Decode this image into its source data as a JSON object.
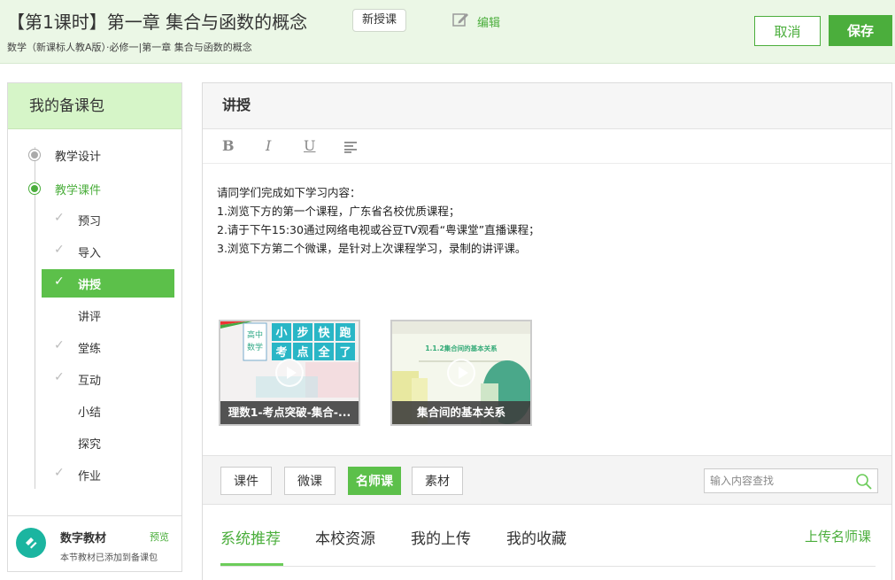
{
  "header": {
    "title": "【第1课时】第一章 集合与函数的概念",
    "lesson_type": "新授课",
    "edit_label": "编辑",
    "subtitle": "数学（新课标人教A版）·必修一|第一章 集合与函数的概念",
    "cancel_label": "取消",
    "save_label": "保存"
  },
  "sidebar": {
    "title": "我的备课包",
    "main_items": [
      {
        "label": "教学设计",
        "active": false
      },
      {
        "label": "教学课件",
        "active": true
      }
    ],
    "sub_items": [
      {
        "label": "预习",
        "checked": true,
        "active": false
      },
      {
        "label": "导入",
        "checked": true,
        "active": false
      },
      {
        "label": "讲授",
        "checked": true,
        "active": true
      },
      {
        "label": "讲评",
        "checked": false,
        "active": false
      },
      {
        "label": "堂练",
        "checked": true,
        "active": false
      },
      {
        "label": "互动",
        "checked": true,
        "active": false
      },
      {
        "label": "小结",
        "checked": false,
        "active": false
      },
      {
        "label": "探究",
        "checked": false,
        "active": false
      },
      {
        "label": "作业",
        "checked": true,
        "active": false
      }
    ],
    "digital": {
      "title": "数字教材",
      "preview_label": "预览",
      "note": "本节教材已添加到备课包"
    }
  },
  "main": {
    "section_title": "讲授",
    "toolbar": {
      "bold": "B",
      "italic": "I",
      "underline": "U"
    },
    "content_lines": [
      "请同学们完成如下学习内容：",
      "1.浏览下方的第一个课程，广东省名校优质课程；",
      "2.请于下午15:30通过网络电视或谷豆TV观看“粤课堂”直播课程；",
      "3.浏览下方第二个微课，是针对上次课程学习，录制的讲评课。"
    ],
    "videos": [
      {
        "caption": "理数1-考点突破-集合-...",
        "thumb_text": [
          "高中",
          "数学",
          "小",
          "步",
          "快",
          "跑",
          "考",
          "点",
          "全",
          "了"
        ]
      },
      {
        "caption": "集合间的基本关系",
        "thumb_text": [
          "1.1.2集合间的基本关系"
        ]
      }
    ],
    "resource_buttons": [
      {
        "label": "课件",
        "active": false
      },
      {
        "label": "微课",
        "active": false
      },
      {
        "label": "名师课",
        "active": true
      },
      {
        "label": "素材",
        "active": false
      }
    ],
    "search_placeholder": "输入内容查找",
    "tabs": [
      {
        "label": "系统推荐",
        "active": true
      },
      {
        "label": "本校资源",
        "active": false
      },
      {
        "label": "我的上传",
        "active": false
      },
      {
        "label": "我的收藏",
        "active": false
      }
    ],
    "upload_label": "上传名师课"
  },
  "colors": {
    "accent": "#4bae3c",
    "header_bg": "#ebf7e6",
    "sidebar_head_bg": "#d6f5c8",
    "active_item_bg": "#5cc04a"
  },
  "icons": [
    "edit-icon",
    "check-icon",
    "digital-textbook-icon",
    "play-icon",
    "search-icon",
    "align-icon"
  ]
}
